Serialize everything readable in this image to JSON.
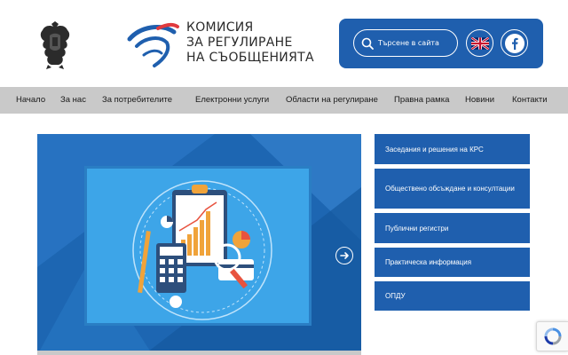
{
  "logo": {
    "line1": "КОМИСИЯ",
    "line2": "ЗА РЕГУЛИРАНЕ",
    "line3": "НА СЪОБЩЕНИЯТА"
  },
  "search": {
    "placeholder": "Търсене в сайта"
  },
  "nav": {
    "items": [
      {
        "label": "Начало"
      },
      {
        "label": "За нас"
      },
      {
        "label": "За потребителите"
      },
      {
        "label": "Електронни услуги"
      },
      {
        "label": "Области на регулиране"
      },
      {
        "label": "Правна рамка"
      },
      {
        "label": "Новини"
      },
      {
        "label": "Контакти"
      }
    ]
  },
  "sidebar": {
    "items": [
      {
        "label": "Заседания и решения на КРС"
      },
      {
        "label": "Обществено обсъждане и консултации"
      },
      {
        "label": "Публични регистри"
      },
      {
        "label": "Практическа информация"
      },
      {
        "label": "ОПДУ"
      }
    ]
  },
  "colors": {
    "brand_blue": "#1f5fae",
    "nav_gray": "#c9c9c9",
    "logo_red": "#e03a3e",
    "logo_blue": "#1f5fae"
  },
  "icons": [
    "coat-of-arms-icon",
    "search-icon",
    "uk-flag-icon",
    "facebook-icon",
    "arrow-right-icon",
    "recaptcha-icon"
  ]
}
